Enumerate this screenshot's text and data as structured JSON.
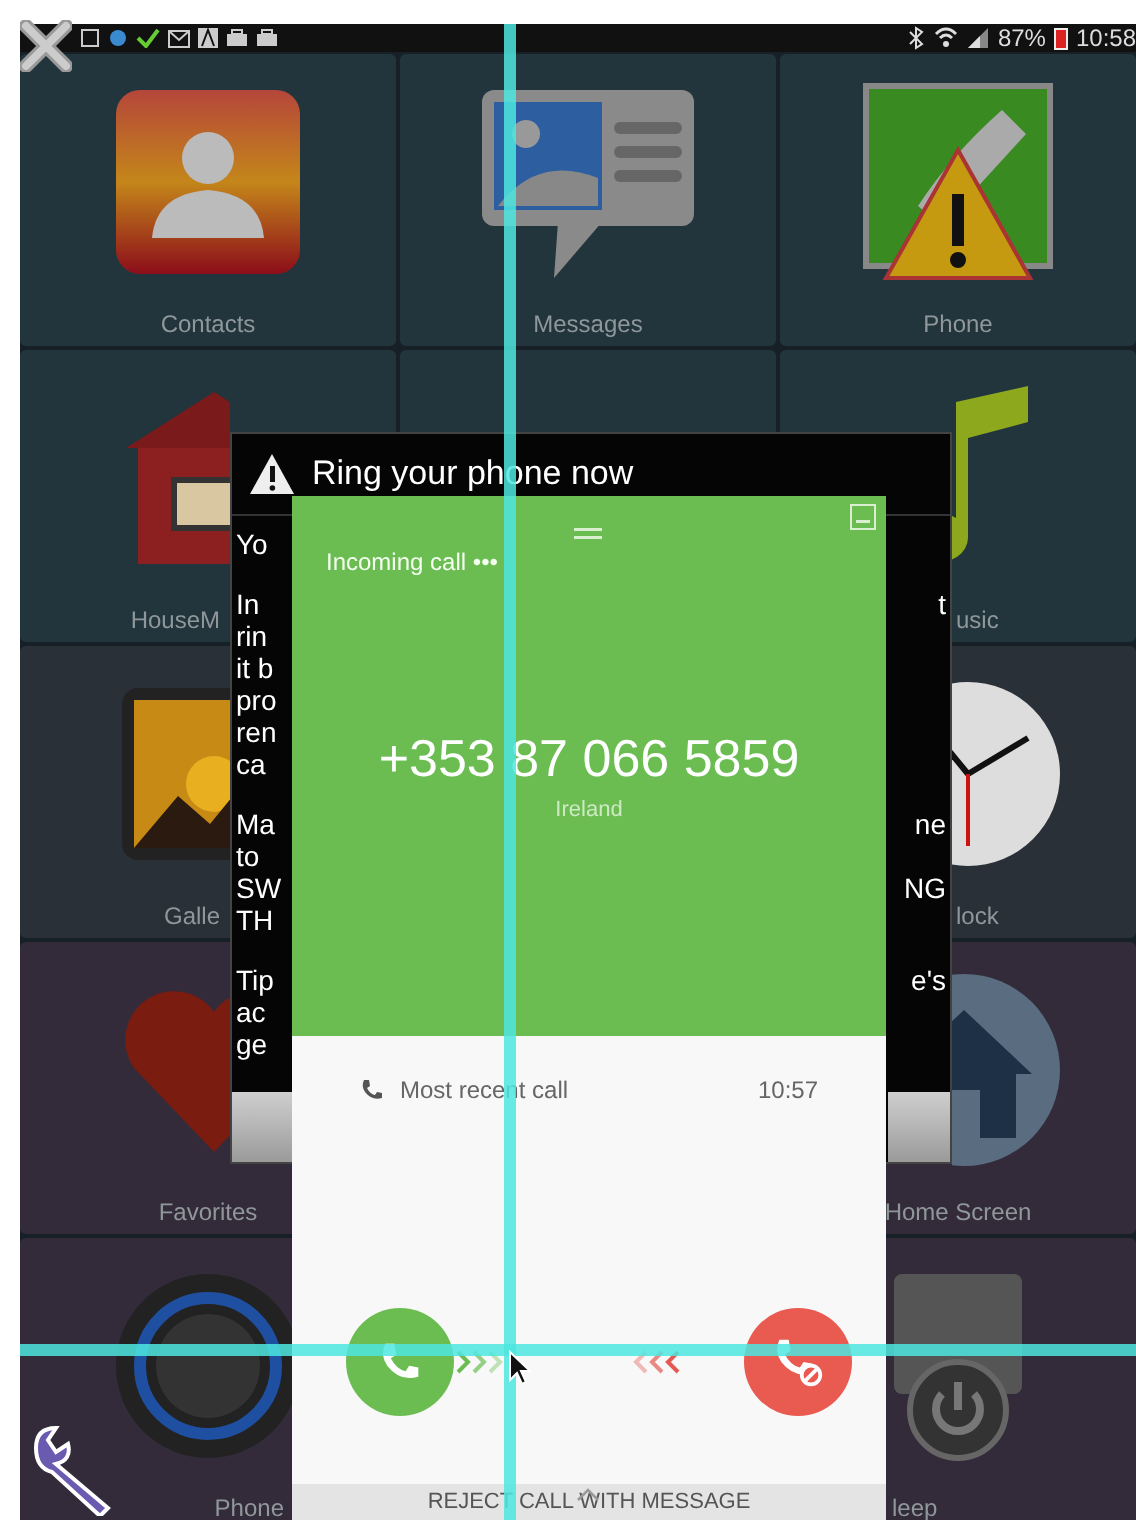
{
  "status_bar": {
    "battery": "87%",
    "time": "10:58"
  },
  "home_tiles": [
    {
      "kind": "contacts",
      "label": "Contacts"
    },
    {
      "kind": "messages",
      "label": "Messages"
    },
    {
      "kind": "phone",
      "label": "Phone"
    },
    {
      "kind": "house",
      "label": "HouseM"
    },
    {
      "kind": "blank"
    },
    {
      "kind": "music",
      "label": "usic"
    },
    {
      "kind": "gallery",
      "label": "Galle"
    },
    {
      "kind": "blank"
    },
    {
      "kind": "clock",
      "label": "lock"
    },
    {
      "kind": "heart",
      "label": "Favorites"
    },
    {
      "kind": "blank"
    },
    {
      "kind": "home",
      "label": "Home Screen"
    },
    {
      "kind": "knob",
      "label": "Phone"
    },
    {
      "kind": "blank"
    },
    {
      "kind": "power",
      "label": "leep"
    }
  ],
  "dialog": {
    "title": "Ring your phone now",
    "paragraphs": [
      {
        "lines": [
          {
            "left": "Yo"
          }
        ]
      },
      {
        "lines": [
          {
            "left": "In",
            "right": "t"
          },
          {
            "left": "rin"
          },
          {
            "left": "it b"
          },
          {
            "left": "pro"
          },
          {
            "left": "ren"
          },
          {
            "left": "ca"
          }
        ]
      },
      {
        "lines": [
          {
            "left": "Ma",
            "right": "ne"
          },
          {
            "left": "to"
          },
          {
            "left": "SW",
            "right": "NG"
          },
          {
            "left": "TH"
          }
        ]
      },
      {
        "lines": [
          {
            "left": "Tip",
            "right": "e's"
          },
          {
            "left": "ac"
          },
          {
            "left": "ge"
          }
        ]
      }
    ]
  },
  "call": {
    "status": "Incoming call",
    "status_dots": "•••",
    "number": "+353 87 066 5859",
    "location": "Ireland",
    "recent_label": "Most recent call",
    "recent_time": "10:57",
    "reject_label": "REJECT CALL WITH MESSAGE"
  }
}
